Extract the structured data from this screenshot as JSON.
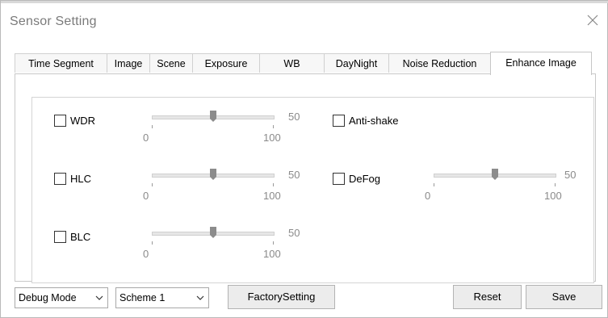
{
  "window": {
    "title": "Sensor Setting"
  },
  "tabs": [
    {
      "label": "Time Segment"
    },
    {
      "label": "Image"
    },
    {
      "label": "Scene"
    },
    {
      "label": "Exposure"
    },
    {
      "label": "WB"
    },
    {
      "label": "DayNight"
    },
    {
      "label": "Noise Reduction"
    },
    {
      "label": "Enhance Image",
      "active": true
    }
  ],
  "settings": {
    "wdr": {
      "label": "WDR",
      "checked": false,
      "value": "50",
      "min": "0",
      "max": "100"
    },
    "hlc": {
      "label": "HLC",
      "checked": false,
      "value": "50",
      "min": "0",
      "max": "100"
    },
    "blc": {
      "label": "BLC",
      "checked": false,
      "value": "50",
      "min": "0",
      "max": "100"
    },
    "anti_shake": {
      "label": "Anti-shake",
      "checked": false
    },
    "defog": {
      "label": "DeFog",
      "checked": false,
      "value": "50",
      "min": "0",
      "max": "100"
    }
  },
  "bottom": {
    "mode_select": "Debug Mode",
    "scheme_select": "Scheme 1",
    "factory_button": "FactorySetting",
    "reset_button": "Reset",
    "save_button": "Save"
  }
}
